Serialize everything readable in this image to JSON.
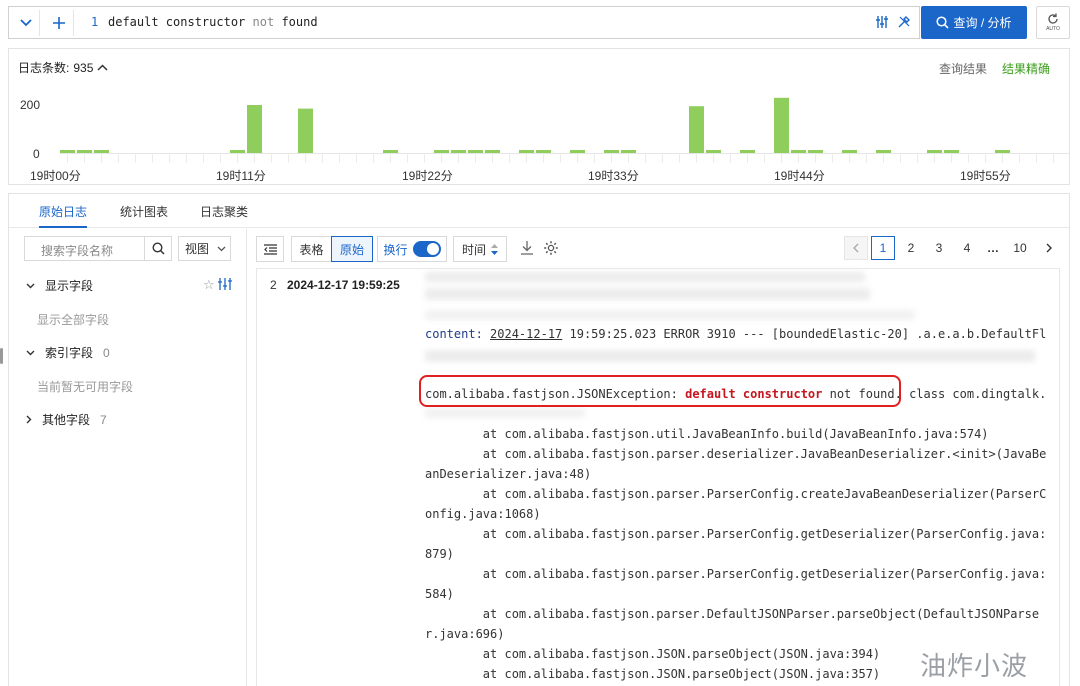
{
  "query": {
    "line_number": "1",
    "tokens": [
      {
        "text": "default constructor",
        "type": "term"
      },
      {
        "text": "not",
        "type": "keyword"
      },
      {
        "text": "found",
        "type": "term"
      }
    ],
    "search_button": "查询 / 分析",
    "auto_label": "AUTO"
  },
  "histogram": {
    "count_label": "日志条数:",
    "count": "935",
    "view_results": "查询结果",
    "result_accurate": "结果精确",
    "y_ticks": [
      "200",
      "0"
    ],
    "x_ticks": [
      "19时00分",
      "19时11分",
      "19时22分",
      "19时33分",
      "19时44分",
      "19时55分"
    ],
    "bar_color": "#8fcd5c",
    "chart_data": {
      "type": "bar",
      "ylim": [
        0,
        250
      ],
      "values": [
        5,
        5,
        5,
        0,
        0,
        0,
        0,
        0,
        0,
        0,
        5,
        200,
        0,
        0,
        185,
        0,
        0,
        0,
        0,
        5,
        0,
        0,
        10,
        7,
        5,
        5,
        0,
        5,
        5,
        0,
        5,
        0,
        5,
        5,
        0,
        0,
        0,
        195,
        5,
        0,
        5,
        0,
        230,
        5,
        5,
        0,
        5,
        0,
        5,
        0,
        0,
        5,
        5,
        0,
        0,
        5,
        0,
        0,
        0,
        0,
        0,
        5
      ]
    }
  },
  "tabs": [
    "原始日志",
    "统计图表",
    "日志聚类"
  ],
  "sidebar": {
    "search_placeholder": "搜索字段名称",
    "view_label": "视图",
    "sections": [
      {
        "label": "显示字段",
        "count": "",
        "sub": "显示全部字段"
      },
      {
        "label": "索引字段",
        "count": "0",
        "sub": "当前暂无可用字段"
      },
      {
        "label": "其他字段",
        "count": "7",
        "sub": ""
      }
    ]
  },
  "toolbar": {
    "table": "表格",
    "raw": "原始",
    "wrap": "换行",
    "time": "时间"
  },
  "pagination": {
    "pages": [
      "1",
      "2",
      "3",
      "4",
      "…",
      "10"
    ],
    "current": "1"
  },
  "log": {
    "index": "2",
    "timestamp": "2024-12-17 19:59:25",
    "content_key": "content:",
    "content_date": "2024-12-17",
    "content_rest": " 19:59:25.023 ERROR 3910 --- [boundedElastic-20] .a.e.a.b.DefaultFl",
    "exception_prefix": "com.alibaba.fastjson.JSONException: ",
    "exception_highlight": "default constructor",
    "exception_mid": " not found.",
    "exception_tail": " class com.dingtalk.",
    "stack": [
      "        at com.alibaba.fastjson.util.JavaBeanInfo.build(JavaBeanInfo.java:574)",
      "        at com.alibaba.fastjson.parser.deserializer.JavaBeanDeserializer.<init>(JavaBe",
      "anDeserializer.java:48)",
      "        at com.alibaba.fastjson.parser.ParserConfig.createJavaBeanDeserializer(ParserC",
      "onfig.java:1068)",
      "        at com.alibaba.fastjson.parser.ParserConfig.getDeserializer(ParserConfig.java:",
      "879)",
      "        at com.alibaba.fastjson.parser.ParserConfig.getDeserializer(ParserConfig.java:",
      "584)",
      "        at com.alibaba.fastjson.parser.DefaultJSONParser.parseObject(DefaultJSONParse",
      "r.java:696)",
      "        at com.alibaba.fastjson.JSON.parseObject(JSON.java:394)",
      "        at com.alibaba.fastjson.JSON.parseObject(JSON.java:357)"
    ]
  },
  "watermark": "油炸小波"
}
